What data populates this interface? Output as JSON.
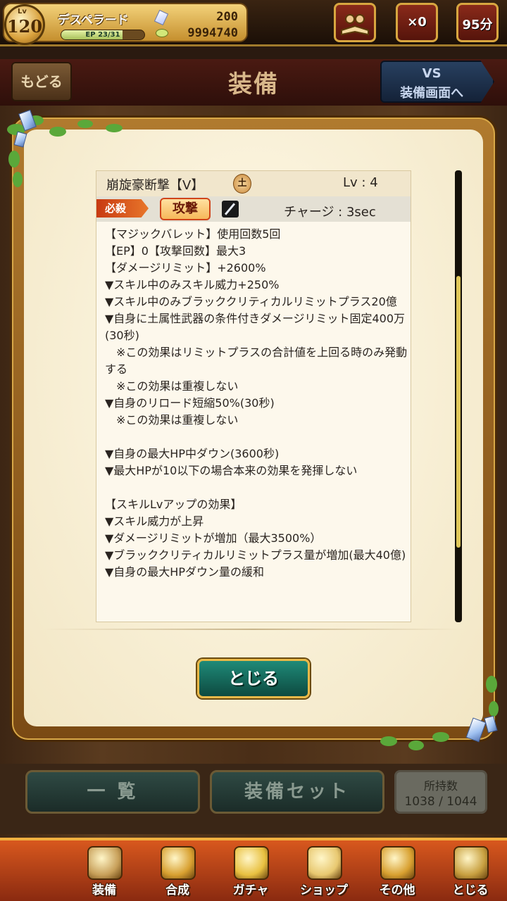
{
  "status": {
    "level_tag": "Lv",
    "level": "120",
    "player_name": "デスペラード",
    "ep_label": "EP",
    "ep_current": "23",
    "ep_max": "31",
    "ep_text": "EP 23/31",
    "ep_fraction": 0.74,
    "gems": "200",
    "coins": "9994740",
    "ticket_count": "×0",
    "timer": "95分"
  },
  "header": {
    "back_label": "もどる",
    "title": "装備",
    "vs_line1": "VS",
    "vs_line2": "装備画面へ"
  },
  "skill": {
    "name": "崩旋豪断撃【V】",
    "element": "土",
    "level": "Lv : 4",
    "tag_special": "必殺",
    "tag_type": "攻撃",
    "charge": "チャージ : 3sec",
    "lines": [
      "【マジックバレット】使用回数5回",
      "【EP】0【攻撃回数】最大3",
      "【ダメージリミット】+2600%",
      "▼スキル中のみスキル威力+250%",
      "▼スキル中のみブラッククリティカルリミットプラス20億",
      "▼自身に土属性武器の条件付きダメージリミット固定400万(30秒)",
      "　※この効果はリミットプラスの合計値を上回る時のみ発動する",
      "　※この効果は重複しない",
      "▼自身のリロード短縮50%(30秒)",
      "　※この効果は重複しない",
      "",
      "▼自身の最大HP中ダウン(3600秒)",
      "▼最大HPが10以下の場合本来の効果を発揮しない",
      "",
      "【スキルLvアップの効果】",
      "▼スキル威力が上昇",
      "▼ダメージリミットが増加（最大3500%）",
      "▼ブラッククリティカルリミットプラス量が増加(最大40億)",
      "▼自身の最大HPダウン量の緩和"
    ]
  },
  "modal": {
    "close_label": "とじる"
  },
  "bottom": {
    "list_label": "一 覧",
    "set_label": "装備セット",
    "owned_label": "所持数",
    "owned_value": "1038 / 1044"
  },
  "nav": [
    {
      "label": "装備",
      "icon": "equipment-icon",
      "color": "#c8a05a"
    },
    {
      "label": "合成",
      "icon": "hammer-icon",
      "color": "#d8a030"
    },
    {
      "label": "ガチャ",
      "icon": "gacha-icon",
      "color": "#e8c040"
    },
    {
      "label": "ショップ",
      "icon": "crystal-shop-icon",
      "color": "#e8c870"
    },
    {
      "label": "その他",
      "icon": "gear-icon",
      "color": "#d8a030"
    },
    {
      "label": "とじる",
      "icon": "close-character-icon",
      "color": "#c8a040"
    }
  ]
}
